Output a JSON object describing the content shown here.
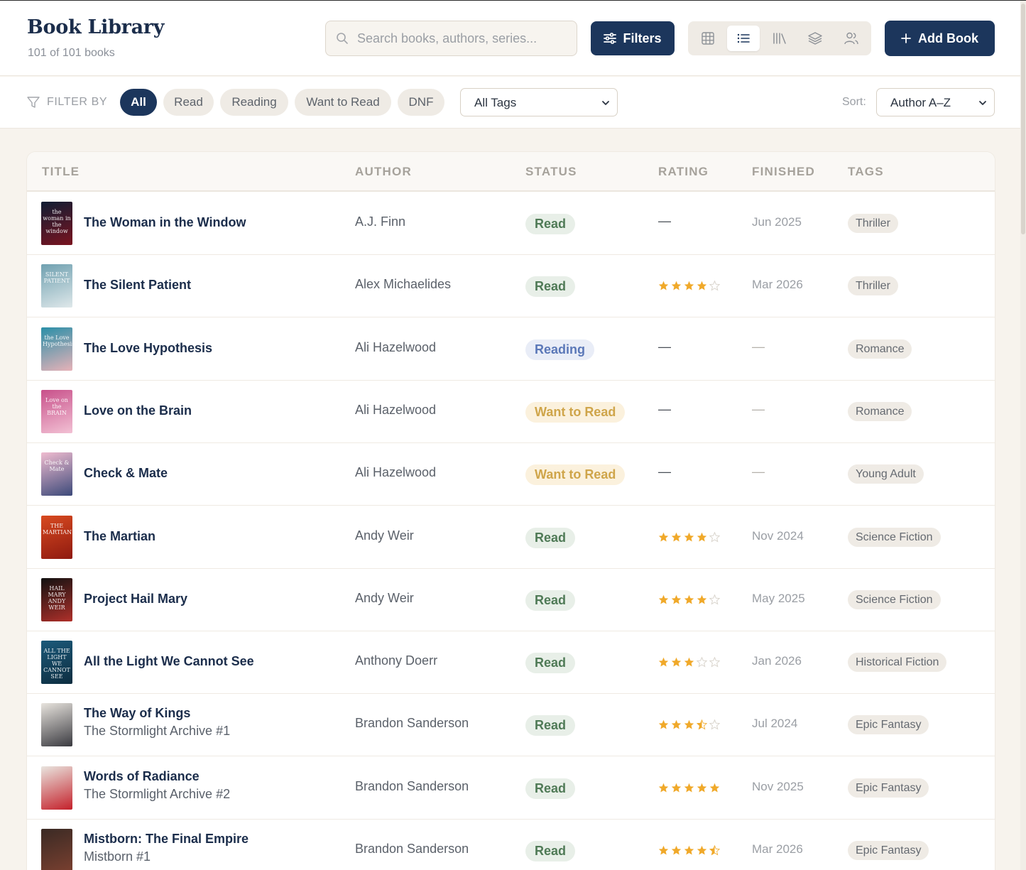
{
  "header": {
    "title": "Book Library",
    "count_text": "101 of 101 books",
    "search_placeholder": "Search books, authors, series...",
    "filters_label": "Filters",
    "add_label": "Add Book",
    "views": [
      "grid-view-icon",
      "list-view-icon",
      "shelf-view-icon",
      "series-view-icon",
      "authors-view-icon"
    ],
    "active_view": "list"
  },
  "filterbar": {
    "label": "FILTER BY",
    "chips": [
      "All",
      "Read",
      "Reading",
      "Want to Read",
      "DNF"
    ],
    "active_chip": "All",
    "tags_select": "All Tags",
    "sort_label": "Sort:",
    "sort_value": "Author A–Z"
  },
  "table": {
    "columns": [
      "TITLE",
      "AUTHOR",
      "STATUS",
      "RATING",
      "FINISHED",
      "TAGS"
    ],
    "rows": [
      {
        "title": "The Woman in the Window",
        "series": "",
        "author": "A.J. Finn",
        "status": "Read",
        "rating": null,
        "finished": "Jun 2025",
        "tag": "Thriller",
        "cover_text": "the woman in the window",
        "cover_colors": [
          "#0f1d33",
          "#7a1420"
        ]
      },
      {
        "title": "The Silent Patient",
        "series": "",
        "author": "Alex Michaelides",
        "status": "Read",
        "rating": 4,
        "finished": "Mar 2026",
        "tag": "Thriller",
        "cover_text": "SILENT PATIENT",
        "cover_colors": [
          "#6fa0b0",
          "#dfe8ea"
        ]
      },
      {
        "title": "The Love Hypothesis",
        "series": "",
        "author": "Ali Hazelwood",
        "status": "Reading",
        "rating": null,
        "finished": "—",
        "tag": "Romance",
        "cover_text": "the Love Hypothesis",
        "cover_colors": [
          "#2a8fa8",
          "#e7b2b8"
        ]
      },
      {
        "title": "Love on the Brain",
        "series": "",
        "author": "Ali Hazelwood",
        "status": "Want to Read",
        "rating": null,
        "finished": "—",
        "tag": "Romance",
        "cover_text": "Love on the BRAIN",
        "cover_colors": [
          "#c8508a",
          "#f2c1d4"
        ]
      },
      {
        "title": "Check & Mate",
        "series": "",
        "author": "Ali Hazelwood",
        "status": "Want to Read",
        "rating": null,
        "finished": "—",
        "tag": "Young Adult",
        "cover_text": "Check & Mate",
        "cover_colors": [
          "#f0bcd0",
          "#3d4a7a"
        ]
      },
      {
        "title": "The Martian",
        "series": "",
        "author": "Andy Weir",
        "status": "Read",
        "rating": 4,
        "finished": "Nov 2024",
        "tag": "Science Fiction",
        "cover_text": "THE MARTIAN",
        "cover_colors": [
          "#d84a20",
          "#8f1a10"
        ]
      },
      {
        "title": "Project Hail Mary",
        "series": "",
        "author": "Andy Weir",
        "status": "Read",
        "rating": 4,
        "finished": "May 2025",
        "tag": "Science Fiction",
        "cover_text": "HAIL MARY ANDY WEIR",
        "cover_colors": [
          "#111111",
          "#b0302a"
        ]
      },
      {
        "title": "All the Light We Cannot See",
        "series": "",
        "author": "Anthony Doerr",
        "status": "Read",
        "rating": 3,
        "finished": "Jan 2026",
        "tag": "Historical Fiction",
        "cover_text": "ALL THE LIGHT WE CANNOT SEE",
        "cover_colors": [
          "#1c5a7a",
          "#0d2d40"
        ]
      },
      {
        "title": "The Way of Kings",
        "series": "The Stormlight Archive #1",
        "author": "Brandon Sanderson",
        "status": "Read",
        "rating": 3.5,
        "finished": "Jul 2024",
        "tag": "Epic Fantasy",
        "cover_text": "",
        "cover_colors": [
          "#e8e4de",
          "#3a3a40"
        ]
      },
      {
        "title": "Words of Radiance",
        "series": "The Stormlight Archive #2",
        "author": "Brandon Sanderson",
        "status": "Read",
        "rating": 5,
        "finished": "Nov 2025",
        "tag": "Epic Fantasy",
        "cover_text": "",
        "cover_colors": [
          "#e9e5df",
          "#c4202a"
        ]
      },
      {
        "title": "Mistborn: The Final Empire",
        "series": "Mistborn #1",
        "author": "Brandon Sanderson",
        "status": "Read",
        "rating": 4.5,
        "finished": "Mar 2026",
        "tag": "Epic Fantasy",
        "cover_text": "",
        "cover_colors": [
          "#3a2a24",
          "#7a4030"
        ]
      }
    ]
  },
  "colors": {
    "primary": "#1c365c",
    "background": "#f7f3ed",
    "star": "#f0a92a",
    "read": "#4f7a56",
    "reading": "#5b78b8",
    "want": "#cfa54a"
  }
}
